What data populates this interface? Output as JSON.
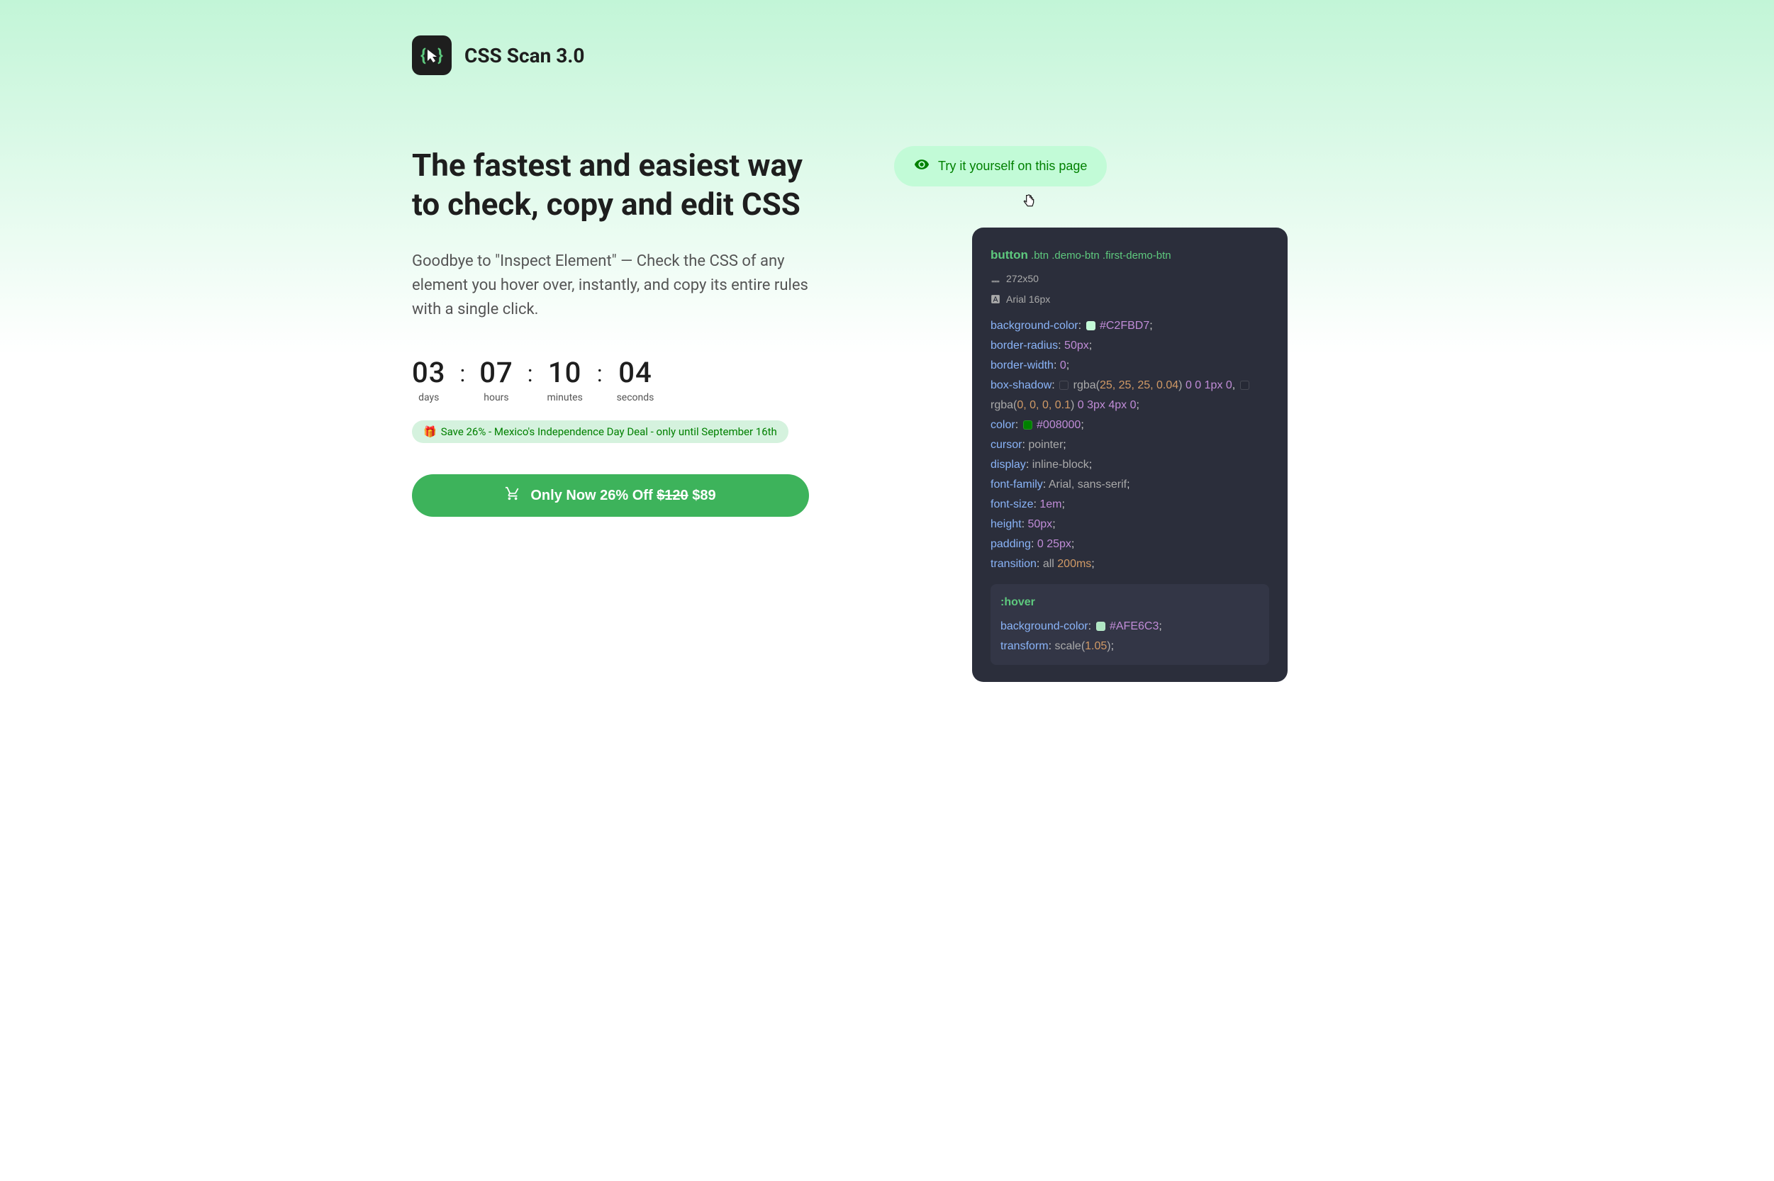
{
  "brand": "CSS Scan 3.0",
  "headline": "The fastest and easiest way to check, copy and edit CSS",
  "subhead": "Goodbye to \"Inspect Element\" — Check the CSS of any element you hover over, instantly, and copy its entire rules with a single click.",
  "countdown": {
    "days": {
      "num": "03",
      "label": "days"
    },
    "hours": {
      "num": "07",
      "label": "hours"
    },
    "minutes": {
      "num": "10",
      "label": "minutes"
    },
    "seconds": {
      "num": "04",
      "label": "seconds"
    },
    "sep": ":"
  },
  "deal": {
    "emoji": "🎁",
    "text": "Save 26% - Mexico's Independence Day Deal - only until September 16th"
  },
  "cta": {
    "prefix": "Only Now 26% Off ",
    "old_price": "$120",
    "new_price": " $89"
  },
  "try_label": "Try it yourself on this page",
  "inspector": {
    "tag": "button",
    "classes": " .btn .demo-btn .first-demo-btn",
    "size": "272x50",
    "font": "Arial 16px",
    "rules": {
      "bg_prop": "background-color",
      "bg_val": "#C2FBD7",
      "br_prop": "border-radius",
      "br_val": "50px",
      "bw_prop": "border-width",
      "bw_val": "0",
      "bs_prop": "box-shadow",
      "bs_val1_pre": " rgba(",
      "bs_val1_nums": "25, 25, 25, 0.04",
      "bs_val1_post": ") ",
      "bs_val1_vals": "0 0 1px 0",
      "bs_val2_pre": " rgba(",
      "bs_val2_nums": "0, 0, 0, 0.1",
      "bs_val2_post": ") ",
      "bs_val2_vals": "0 3px 4px 0",
      "color_prop": "color",
      "color_val": "#008000",
      "cursor_prop": "cursor",
      "cursor_val": "pointer",
      "display_prop": "display",
      "display_val": "inline-block",
      "ff_prop": "font-family",
      "ff_val": "Arial, sans-serif",
      "fs_prop": "font-size",
      "fs_val": "1em",
      "h_prop": "height",
      "h_val": "50px",
      "p_prop": "padding",
      "p_val": "0 25px",
      "t_prop": "transition",
      "t_val1": "all ",
      "t_val2": "200ms"
    },
    "hover": {
      "title": ":hover",
      "bg_prop": "background-color",
      "bg_val": "#AFE6C3",
      "tf_prop": "transform",
      "tf_val1": "scale(",
      "tf_val2": "1.05",
      "tf_val3": ")"
    }
  },
  "colors": {
    "swatch_bg": "#C2FBD7",
    "swatch_color": "#008000",
    "swatch_hover": "#AFE6C3",
    "swatch_shadow1": "rgba(25,25,25,0.04)",
    "swatch_shadow2": "rgba(0,0,0,0.1)"
  }
}
